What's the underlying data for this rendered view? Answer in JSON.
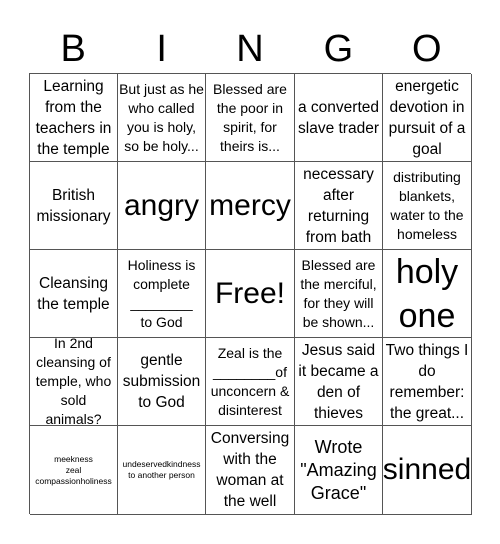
{
  "header": {
    "letters": [
      "B",
      "I",
      "N",
      "G",
      "O"
    ]
  },
  "cells": [
    [
      "Learning from the teachers in the temple",
      "But just as he who called you is holy, so be holy...",
      "Blessed are the poor in spirit, for theirs is...",
      "a converted slave trader",
      "energetic devotion in pursuit of a goal"
    ],
    [
      "British missionary",
      "angry",
      "mercy",
      "necessary after returning from bath",
      "distributing blankets, water to the homeless"
    ],
    [
      "Cleansing the temple",
      "Holiness is complete\n________\nto God",
      "Free!",
      "Blessed are the merciful, for they will be shown...",
      "holy one"
    ],
    [
      "In 2nd cleansing of temple, who sold animals?",
      "gentle submission to God",
      "Zeal is the ________of unconcern & disinterest",
      "Jesus said it became a den of thieves",
      "Two things I do remember: the great..."
    ],
    [
      "meekness\nzeal\ncompassionholiness",
      "undeservedkindness to another person",
      "Conversing with the woman at the well",
      "Wrote \"Amazing Grace\"",
      "sinned"
    ]
  ]
}
